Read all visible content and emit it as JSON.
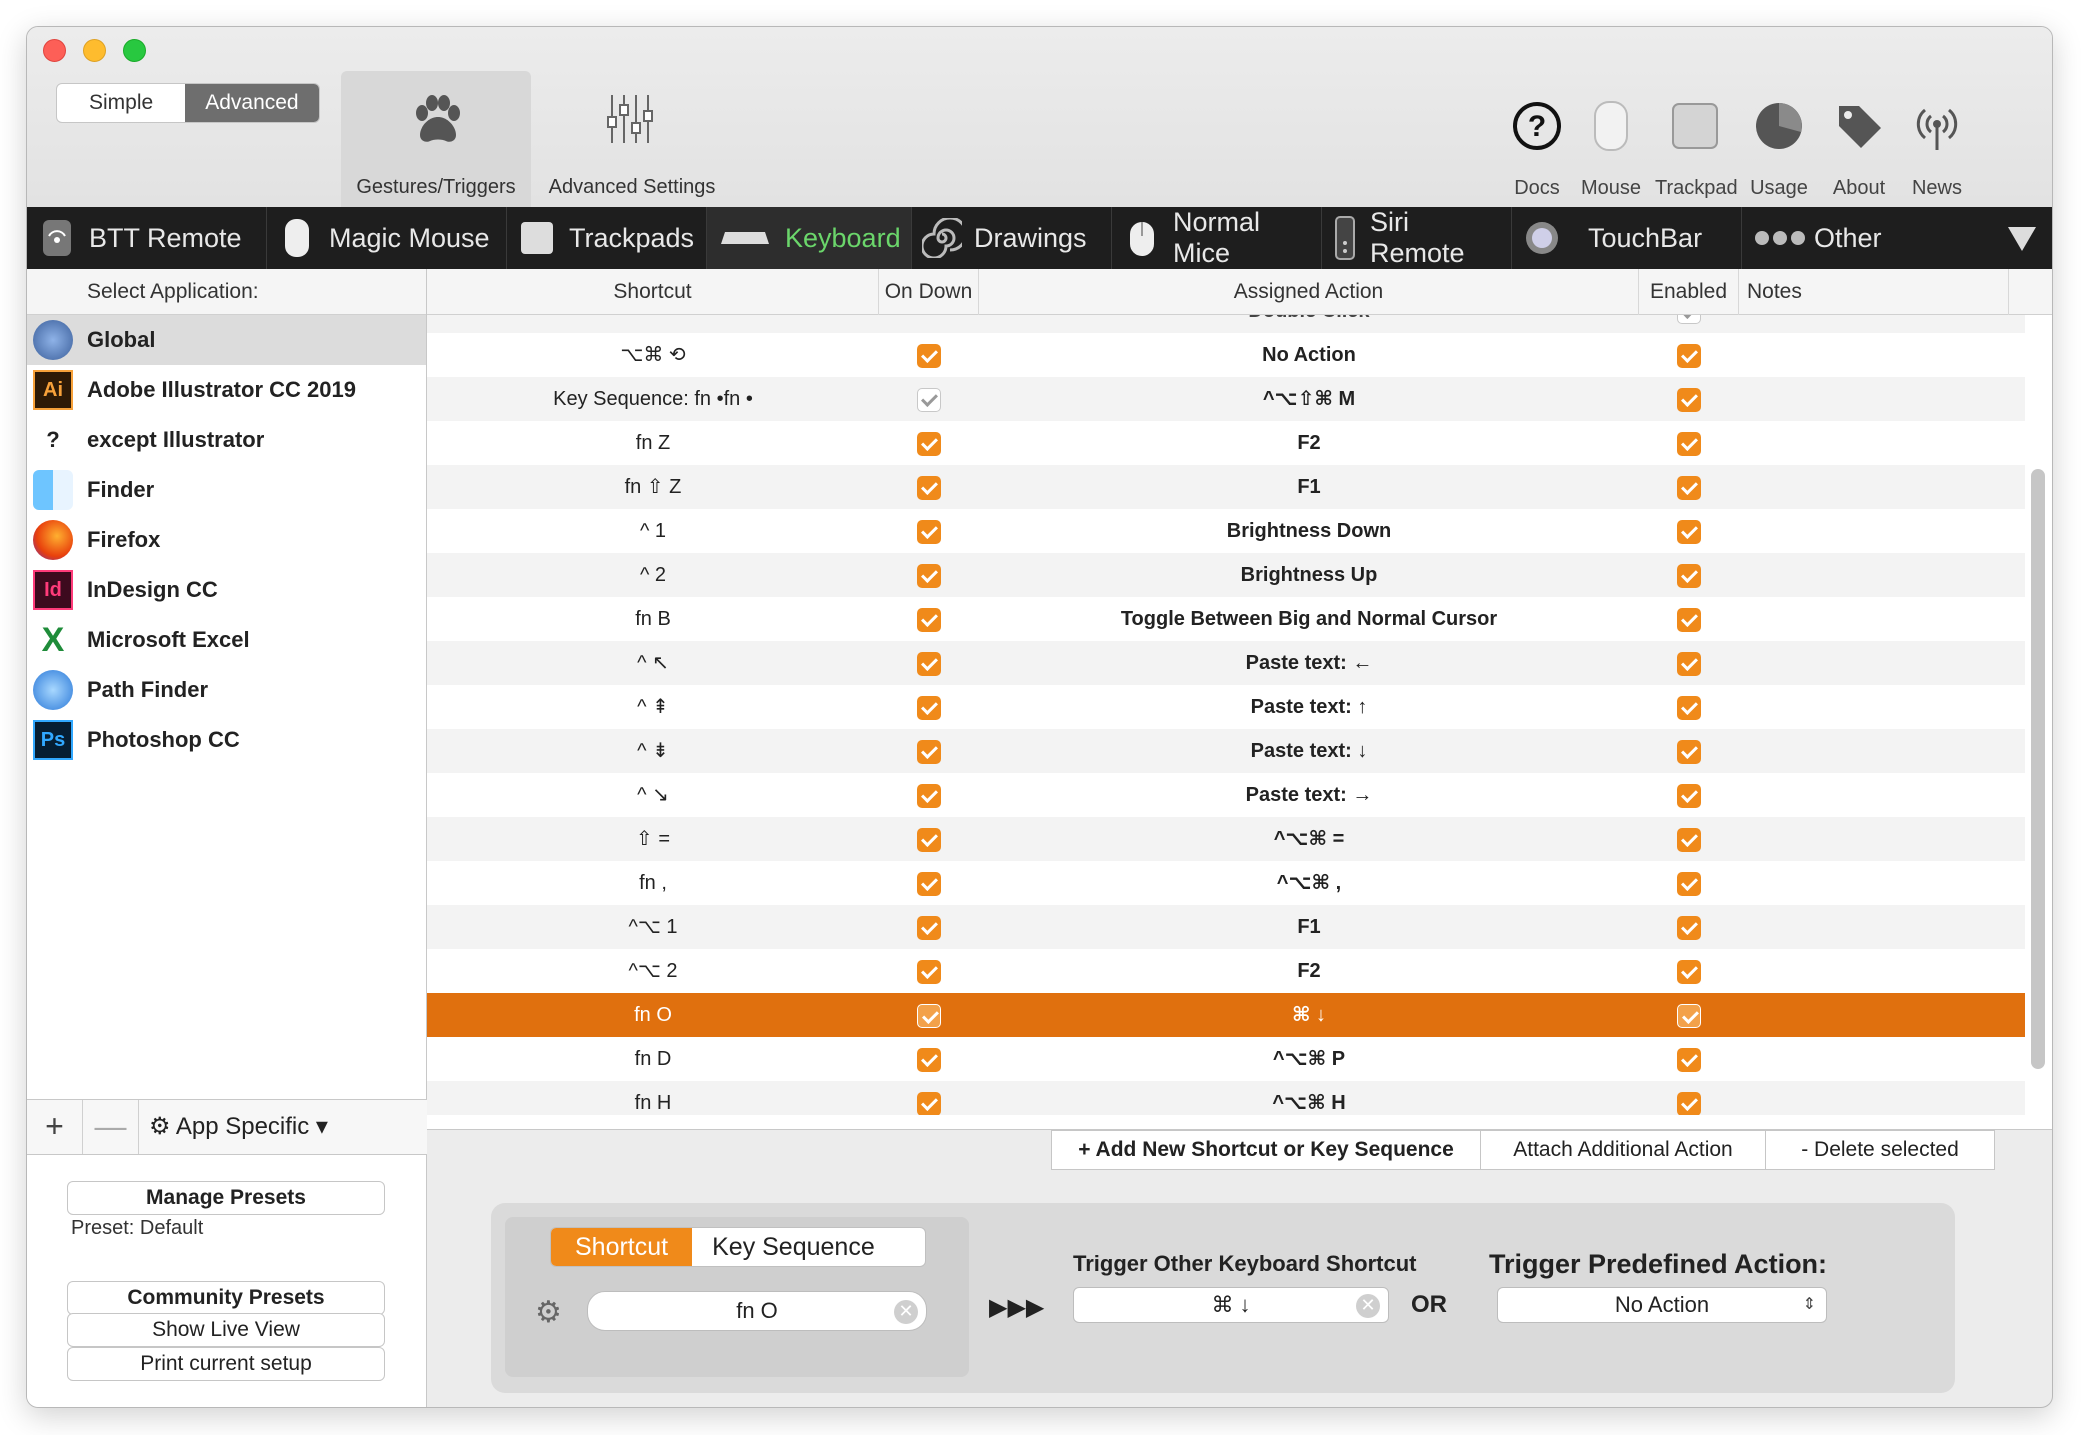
{
  "toolbar": {
    "mode_simple": "Simple",
    "mode_advanced": "Advanced",
    "tab_gestures": "Gestures/Triggers",
    "tab_advanced_settings": "Advanced Settings",
    "right_icons": [
      {
        "label": "Docs",
        "icon": "question-icon"
      },
      {
        "label": "Mouse",
        "icon": "mouse-icon"
      },
      {
        "label": "Trackpad",
        "icon": "trackpad-icon"
      },
      {
        "label": "Usage",
        "icon": "pie-chart-icon"
      },
      {
        "label": "About",
        "icon": "tag-icon"
      },
      {
        "label": "News",
        "icon": "broadcast-icon"
      }
    ]
  },
  "devices": [
    {
      "label": "BTT Remote",
      "icon": "remote-icon"
    },
    {
      "label": "Magic Mouse",
      "icon": "magic-mouse-icon"
    },
    {
      "label": "Trackpads",
      "icon": "trackpad-icon"
    },
    {
      "label": "Keyboard",
      "icon": "keyboard-icon"
    },
    {
      "label": "Drawings",
      "icon": "spiral-icon"
    },
    {
      "label": "Normal Mice",
      "icon": "mouse-icon"
    },
    {
      "label": "Siri Remote",
      "icon": "siri-remote-icon"
    },
    {
      "label": "TouchBar",
      "icon": "touchbar-icon"
    },
    {
      "label": "Other",
      "icon": "other-icon"
    }
  ],
  "sidebar": {
    "header": "Select Application:",
    "apps": [
      {
        "name": "Global",
        "icon": "globe-icon",
        "badge": ""
      },
      {
        "name": "Adobe Illustrator CC 2019",
        "icon": "illustrator-icon",
        "badge": "Ai"
      },
      {
        "name": "except Illustrator",
        "icon": "question-mark-icon",
        "badge": "?"
      },
      {
        "name": "Finder",
        "icon": "finder-icon",
        "badge": ""
      },
      {
        "name": "Firefox",
        "icon": "firefox-icon",
        "badge": ""
      },
      {
        "name": "InDesign CC",
        "icon": "indesign-icon",
        "badge": "Id"
      },
      {
        "name": "Microsoft Excel",
        "icon": "excel-icon",
        "badge": "X"
      },
      {
        "name": "Path Finder",
        "icon": "pathfinder-icon",
        "badge": ""
      },
      {
        "name": "Photoshop CC",
        "icon": "photoshop-icon",
        "badge": "Ps"
      }
    ],
    "add": "+",
    "remove": "—",
    "app_specific": "App Specific ▾"
  },
  "presets": {
    "manage": "Manage Presets",
    "current": "Preset: Default",
    "community": "Community Presets",
    "live_view": "Show Live View",
    "print": "Print current setup"
  },
  "table": {
    "headers": {
      "shortcut": "Shortcut",
      "on_down": "On Down",
      "action": "Assigned Action",
      "enabled": "Enabled",
      "notes": "Notes"
    },
    "partial_row_action": "Double Click",
    "rows": [
      {
        "shortcut": "⌥⌘ ⟲",
        "on_down": true,
        "action": "No Action",
        "enabled": true
      },
      {
        "shortcut": "Key Sequence: fn •fn •",
        "on_down": false,
        "action": "^⌥⇧⌘ M",
        "enabled": true
      },
      {
        "shortcut": "fn  Z",
        "on_down": true,
        "action": "F2",
        "enabled": true
      },
      {
        "shortcut": "fn ⇧ Z",
        "on_down": true,
        "action": "F1",
        "enabled": true
      },
      {
        "shortcut": "^ 1",
        "on_down": true,
        "action": "Brightness Down",
        "enabled": true
      },
      {
        "shortcut": "^ 2",
        "on_down": true,
        "action": "Brightness Up",
        "enabled": true
      },
      {
        "shortcut": "fn  B",
        "on_down": true,
        "action": "Toggle Between Big and Normal Cursor",
        "enabled": true
      },
      {
        "shortcut": "^ ↖",
        "on_down": true,
        "action": "Paste text: ←",
        "enabled": true
      },
      {
        "shortcut": "^ ⇞",
        "on_down": true,
        "action": "Paste text: ↑",
        "enabled": true
      },
      {
        "shortcut": "^ ⇟",
        "on_down": true,
        "action": "Paste text: ↓",
        "enabled": true
      },
      {
        "shortcut": "^ ↘",
        "on_down": true,
        "action": "Paste text: →",
        "enabled": true
      },
      {
        "shortcut": "⇧ =",
        "on_down": true,
        "action": "^⌥⌘ =",
        "enabled": true
      },
      {
        "shortcut": "fn  ,",
        "on_down": true,
        "action": "^⌥⌘ ,",
        "enabled": true
      },
      {
        "shortcut": "^⌥ 1",
        "on_down": true,
        "action": "F1",
        "enabled": true
      },
      {
        "shortcut": "^⌥ 2",
        "on_down": true,
        "action": "F2",
        "enabled": true
      },
      {
        "shortcut": "fn  O",
        "on_down": true,
        "action": "⌘ ↓",
        "enabled": true,
        "selected": true
      },
      {
        "shortcut": "fn  D",
        "on_down": true,
        "action": "^⌥⌘ P",
        "enabled": true
      },
      {
        "shortcut": "fn  H",
        "on_down": true,
        "action": "^⌥⌘ H",
        "enabled": true
      }
    ]
  },
  "actions": {
    "add": "+ Add New Shortcut or Key Sequence",
    "attach": "Attach Additional Action",
    "delete": "- Delete selected"
  },
  "editor": {
    "tab_shortcut": "Shortcut",
    "tab_sequence": "Key Sequence",
    "shortcut_value": "fn O",
    "arrows": "▶▶▶",
    "trigger_other_label": "Trigger Other Keyboard Shortcut",
    "trigger_other_value": "⌘ ↓",
    "or": "OR",
    "predefined_label": "Trigger Predefined Action:",
    "predefined_value": "No Action"
  },
  "colors": {
    "accent": "#f08a1a",
    "selected_row": "#e0700e",
    "keyboard_tab_text": "#6bd66b"
  }
}
